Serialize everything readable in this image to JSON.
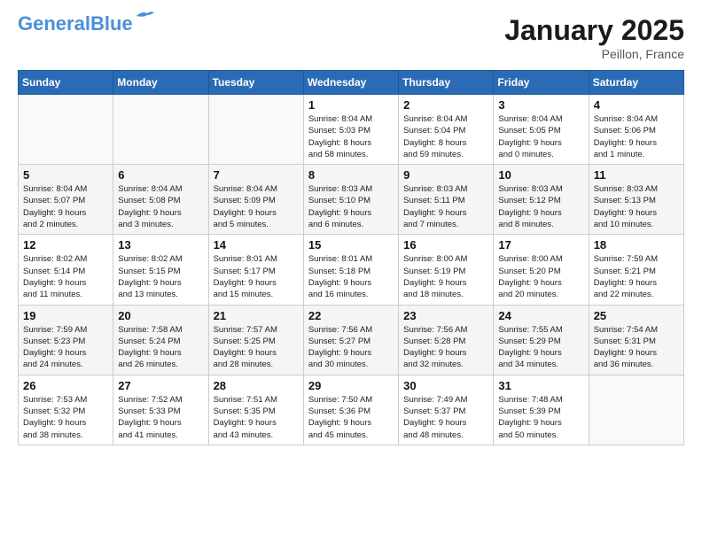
{
  "header": {
    "logo_line1": "General",
    "logo_line2": "Blue",
    "month": "January 2025",
    "location": "Peillon, France"
  },
  "weekdays": [
    "Sunday",
    "Monday",
    "Tuesday",
    "Wednesday",
    "Thursday",
    "Friday",
    "Saturday"
  ],
  "weeks": [
    [
      {
        "day": "",
        "info": ""
      },
      {
        "day": "",
        "info": ""
      },
      {
        "day": "",
        "info": ""
      },
      {
        "day": "1",
        "info": "Sunrise: 8:04 AM\nSunset: 5:03 PM\nDaylight: 8 hours\nand 58 minutes."
      },
      {
        "day": "2",
        "info": "Sunrise: 8:04 AM\nSunset: 5:04 PM\nDaylight: 8 hours\nand 59 minutes."
      },
      {
        "day": "3",
        "info": "Sunrise: 8:04 AM\nSunset: 5:05 PM\nDaylight: 9 hours\nand 0 minutes."
      },
      {
        "day": "4",
        "info": "Sunrise: 8:04 AM\nSunset: 5:06 PM\nDaylight: 9 hours\nand 1 minute."
      }
    ],
    [
      {
        "day": "5",
        "info": "Sunrise: 8:04 AM\nSunset: 5:07 PM\nDaylight: 9 hours\nand 2 minutes."
      },
      {
        "day": "6",
        "info": "Sunrise: 8:04 AM\nSunset: 5:08 PM\nDaylight: 9 hours\nand 3 minutes."
      },
      {
        "day": "7",
        "info": "Sunrise: 8:04 AM\nSunset: 5:09 PM\nDaylight: 9 hours\nand 5 minutes."
      },
      {
        "day": "8",
        "info": "Sunrise: 8:03 AM\nSunset: 5:10 PM\nDaylight: 9 hours\nand 6 minutes."
      },
      {
        "day": "9",
        "info": "Sunrise: 8:03 AM\nSunset: 5:11 PM\nDaylight: 9 hours\nand 7 minutes."
      },
      {
        "day": "10",
        "info": "Sunrise: 8:03 AM\nSunset: 5:12 PM\nDaylight: 9 hours\nand 8 minutes."
      },
      {
        "day": "11",
        "info": "Sunrise: 8:03 AM\nSunset: 5:13 PM\nDaylight: 9 hours\nand 10 minutes."
      }
    ],
    [
      {
        "day": "12",
        "info": "Sunrise: 8:02 AM\nSunset: 5:14 PM\nDaylight: 9 hours\nand 11 minutes."
      },
      {
        "day": "13",
        "info": "Sunrise: 8:02 AM\nSunset: 5:15 PM\nDaylight: 9 hours\nand 13 minutes."
      },
      {
        "day": "14",
        "info": "Sunrise: 8:01 AM\nSunset: 5:17 PM\nDaylight: 9 hours\nand 15 minutes."
      },
      {
        "day": "15",
        "info": "Sunrise: 8:01 AM\nSunset: 5:18 PM\nDaylight: 9 hours\nand 16 minutes."
      },
      {
        "day": "16",
        "info": "Sunrise: 8:00 AM\nSunset: 5:19 PM\nDaylight: 9 hours\nand 18 minutes."
      },
      {
        "day": "17",
        "info": "Sunrise: 8:00 AM\nSunset: 5:20 PM\nDaylight: 9 hours\nand 20 minutes."
      },
      {
        "day": "18",
        "info": "Sunrise: 7:59 AM\nSunset: 5:21 PM\nDaylight: 9 hours\nand 22 minutes."
      }
    ],
    [
      {
        "day": "19",
        "info": "Sunrise: 7:59 AM\nSunset: 5:23 PM\nDaylight: 9 hours\nand 24 minutes."
      },
      {
        "day": "20",
        "info": "Sunrise: 7:58 AM\nSunset: 5:24 PM\nDaylight: 9 hours\nand 26 minutes."
      },
      {
        "day": "21",
        "info": "Sunrise: 7:57 AM\nSunset: 5:25 PM\nDaylight: 9 hours\nand 28 minutes."
      },
      {
        "day": "22",
        "info": "Sunrise: 7:56 AM\nSunset: 5:27 PM\nDaylight: 9 hours\nand 30 minutes."
      },
      {
        "day": "23",
        "info": "Sunrise: 7:56 AM\nSunset: 5:28 PM\nDaylight: 9 hours\nand 32 minutes."
      },
      {
        "day": "24",
        "info": "Sunrise: 7:55 AM\nSunset: 5:29 PM\nDaylight: 9 hours\nand 34 minutes."
      },
      {
        "day": "25",
        "info": "Sunrise: 7:54 AM\nSunset: 5:31 PM\nDaylight: 9 hours\nand 36 minutes."
      }
    ],
    [
      {
        "day": "26",
        "info": "Sunrise: 7:53 AM\nSunset: 5:32 PM\nDaylight: 9 hours\nand 38 minutes."
      },
      {
        "day": "27",
        "info": "Sunrise: 7:52 AM\nSunset: 5:33 PM\nDaylight: 9 hours\nand 41 minutes."
      },
      {
        "day": "28",
        "info": "Sunrise: 7:51 AM\nSunset: 5:35 PM\nDaylight: 9 hours\nand 43 minutes."
      },
      {
        "day": "29",
        "info": "Sunrise: 7:50 AM\nSunset: 5:36 PM\nDaylight: 9 hours\nand 45 minutes."
      },
      {
        "day": "30",
        "info": "Sunrise: 7:49 AM\nSunset: 5:37 PM\nDaylight: 9 hours\nand 48 minutes."
      },
      {
        "day": "31",
        "info": "Sunrise: 7:48 AM\nSunset: 5:39 PM\nDaylight: 9 hours\nand 50 minutes."
      },
      {
        "day": "",
        "info": ""
      }
    ]
  ]
}
